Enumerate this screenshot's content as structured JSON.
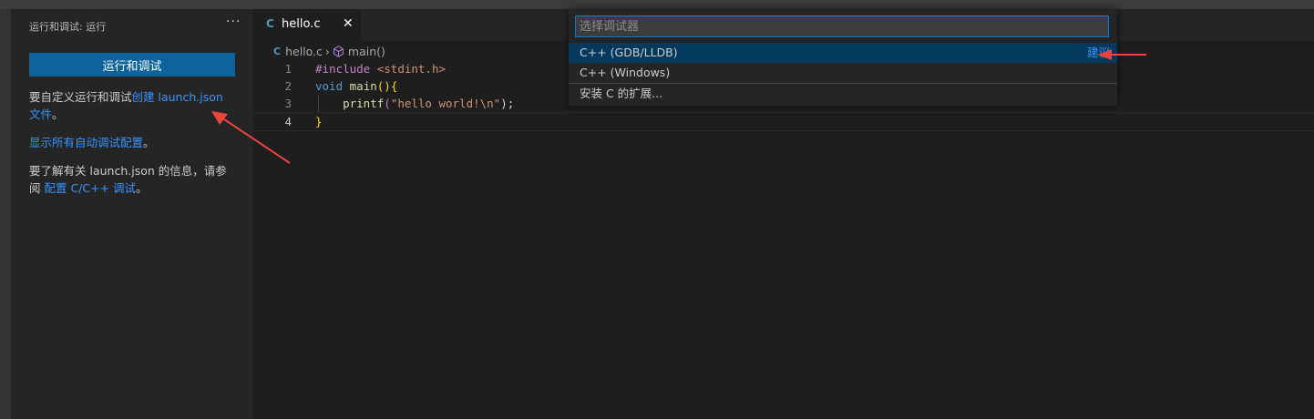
{
  "sidebar": {
    "title": "运行和调试: 运行",
    "more": "···",
    "run_button": "运行和调试",
    "para1_text": "要自定义运行和调试",
    "para1_link": "创建 launch.json 文件",
    "para1_end": "。",
    "para2_link": "显示所有自动调试配置",
    "para2_end": "。",
    "para3_text": "要了解有关 launch.json 的信息，请参阅",
    "para3_link": "配置 C/C++ 调试",
    "para3_end": "。"
  },
  "tab": {
    "icon": "C",
    "label": "hello.c",
    "close": "✕"
  },
  "breadcrumb": {
    "file_icon": "C",
    "file": "hello.c",
    "separator": "›",
    "symbol": "main()"
  },
  "editor": {
    "lines": [
      {
        "num": "1",
        "pp": "#include",
        "sp": " ",
        "hdr": "<stdint.h>"
      },
      {
        "num": "2",
        "kw": "void",
        "sp": " ",
        "fn": "main",
        "paren": "()",
        "brace": "{"
      },
      {
        "num": "3",
        "indent": "    ",
        "fn": "printf",
        "open": "(",
        "str": "\"hello world!\\n\"",
        "close": ");"
      },
      {
        "num": "4",
        "brace": "}"
      }
    ]
  },
  "quickpick": {
    "placeholder": "选择调试器",
    "items": [
      {
        "label": "C++ (GDB/LLDB)",
        "tag": "建议"
      },
      {
        "label": "C++ (Windows)"
      },
      {
        "label": "安装 C 的扩展..."
      }
    ]
  },
  "colors": {
    "accent_button": "#0e639c",
    "link": "#3794ff",
    "annotation_arrow": "#e8453c"
  }
}
